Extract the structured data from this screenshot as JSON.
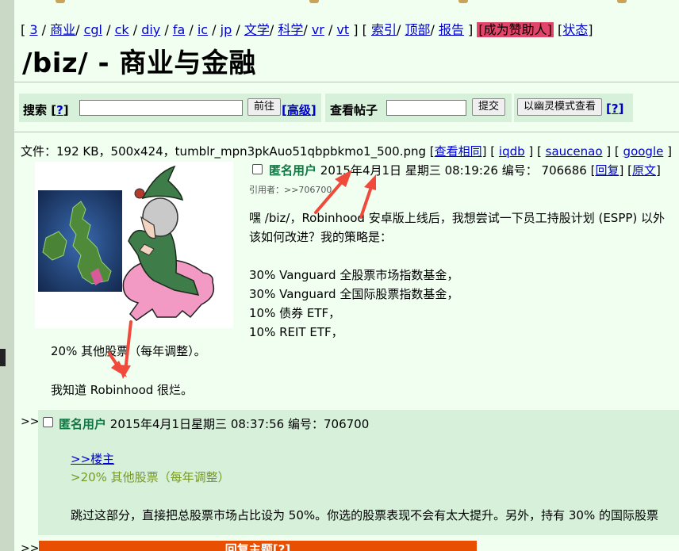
{
  "board_nav": {
    "open": "[",
    "boards": [
      "3",
      "商业",
      "cgl",
      "ck",
      "diy",
      "fa",
      "ic",
      "jp",
      "文学",
      "科学",
      "vr",
      "vt"
    ],
    "close": "]",
    "links": [
      "索引",
      "顶部",
      "报告"
    ],
    "donate": "成为赞助人",
    "status": "状态"
  },
  "board_title": "/biz/ - 商业与金融",
  "search": {
    "label": "搜索",
    "help": "?",
    "value": "",
    "go_button": "前往",
    "advanced": "高级"
  },
  "view_post": {
    "label": "查看帖子",
    "value": "",
    "submit_button": "提交"
  },
  "ghost": {
    "button": "以幽灵模式查看",
    "help": "?"
  },
  "file": {
    "prefix": "文件：",
    "details": "192 KB，500x424，tumblr_mpn3pkAuo51qbpbkmo1_500.png",
    "links": [
      "查看相同",
      "iqdb",
      "saucenao",
      "google"
    ]
  },
  "op": {
    "name": "匿名用户",
    "datetime": "2015年4月1日 星期三 08:19:26",
    "number_label": "编号：",
    "number": "706686",
    "reply_link": "回复",
    "original_link": "原文",
    "backlinks_label": "引用者：",
    "backlinks": ">>706700",
    "body": [
      "嘿 /biz/，Robinhood 安卓版上线后，我想尝试一下员工持股计划 (ESPP) 以外",
      "该如何改进？我的策略是：",
      "30% Vanguard 全股票市场指数基金，",
      "30% Vanguard 全国际股票指数基金，",
      "10% 债券 ETF，",
      "10% REIT ETF，",
      "20% 其他股票（每年调整）。",
      "我知道 Robinhood 很烂。"
    ]
  },
  "reply": {
    "arrow": ">>",
    "name": "匿名用户",
    "datetime": "2015年4月1日星期三 08:37:56",
    "number_label": "编号：",
    "number": "706700",
    "quote_link": ">>楼主",
    "greentext": ">20% 其他股票（每年调整）",
    "body": "跳过这部分，直接把总股票市场占比设为 50%。你选的股票表现不会有太大提升。另外，持有 30% 的国际股票"
  },
  "bottom": {
    "arrow": ">>",
    "bar_label": "回复主题",
    "bar_help": "[?]"
  },
  "colors": {
    "background": "#f0fff0",
    "post_box": "#d6f0da",
    "name": "#117743",
    "link": "#0000cc",
    "greentext": "#789922",
    "donate": "#e2456a",
    "annotation_arrow": "#f04a3c",
    "bottom_bar": "#e84f00"
  },
  "icons": [
    "checkbox",
    "annotation-arrow"
  ]
}
